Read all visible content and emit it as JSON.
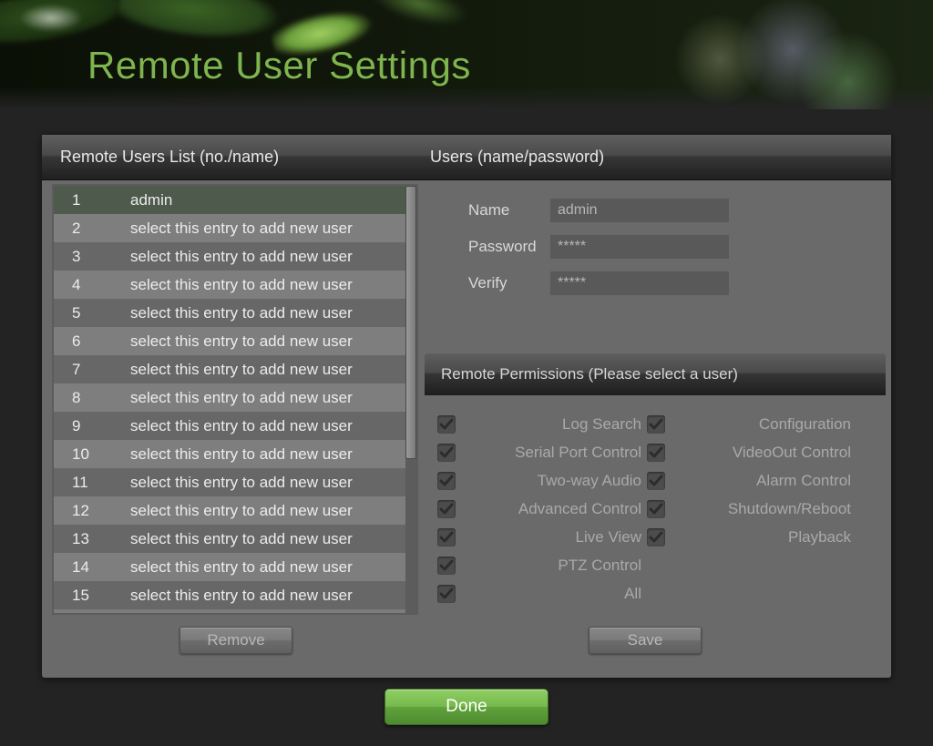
{
  "page_title": "Remote User Settings",
  "headers": {
    "list_header": "Remote Users List (no./name)",
    "form_header": "Users (name/password)"
  },
  "user_list": [
    {
      "no": "1",
      "name": "admin",
      "selected": true
    },
    {
      "no": "2",
      "name": "select this entry to add new user"
    },
    {
      "no": "3",
      "name": "select this entry to add new user"
    },
    {
      "no": "4",
      "name": "select this entry to add new user"
    },
    {
      "no": "5",
      "name": "select this entry to add new user"
    },
    {
      "no": "6",
      "name": "select this entry to add new user"
    },
    {
      "no": "7",
      "name": "select this entry to add new user"
    },
    {
      "no": "8",
      "name": "select this entry to add new user"
    },
    {
      "no": "9",
      "name": "select this entry to add new user"
    },
    {
      "no": "10",
      "name": "select this entry to add new user"
    },
    {
      "no": "11",
      "name": "select this entry to add new user"
    },
    {
      "no": "12",
      "name": "select this entry to add new user"
    },
    {
      "no": "13",
      "name": "select this entry to add new user"
    },
    {
      "no": "14",
      "name": "select this entry to add new user"
    },
    {
      "no": "15",
      "name": "select this entry to add new user"
    }
  ],
  "form": {
    "name_label": "Name",
    "name_value": "admin",
    "password_label": "Password",
    "password_value": "*****",
    "verify_label": "Verify",
    "verify_value": "*****"
  },
  "permissions": {
    "header": "Remote Permissions (Please select a user)",
    "col1": [
      {
        "label": "Log Search",
        "checked": true
      },
      {
        "label": "Serial Port Control",
        "checked": true
      },
      {
        "label": "Two-way Audio",
        "checked": true
      },
      {
        "label": "Advanced Control",
        "checked": true
      },
      {
        "label": "Live View",
        "checked": true
      },
      {
        "label": "PTZ Control",
        "checked": true
      },
      {
        "label": "All",
        "checked": true
      }
    ],
    "col2": [
      {
        "label": "Configuration",
        "checked": true
      },
      {
        "label": "VideoOut Control",
        "checked": true
      },
      {
        "label": "Alarm Control",
        "checked": true
      },
      {
        "label": "Shutdown/Reboot",
        "checked": true
      },
      {
        "label": "Playback",
        "checked": true
      }
    ]
  },
  "buttons": {
    "remove": "Remove",
    "save": "Save",
    "done": "Done"
  },
  "colors": {
    "accent_green": "#7eb54e",
    "panel_grey": "#6a6a6a"
  }
}
